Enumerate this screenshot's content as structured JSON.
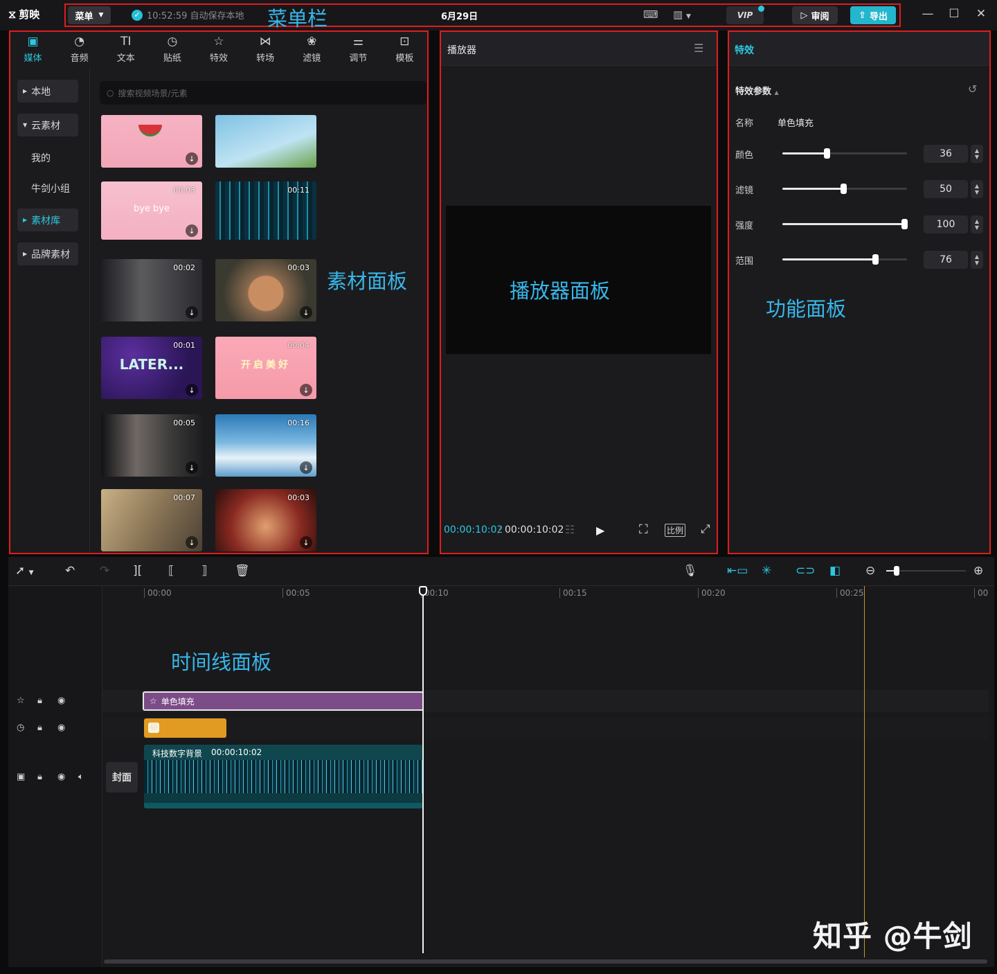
{
  "app": {
    "name": "剪映",
    "menu_label": "菜单",
    "autosave": "10:52:59 自动保存本地",
    "date": "6月29日",
    "vip_label": "VIP",
    "review_label": "审阅",
    "export_label": "导出"
  },
  "annotations": {
    "menubar": "菜单栏",
    "media": "素材面板",
    "player": "播放器面板",
    "function": "功能面板",
    "timeline": "时间线面板"
  },
  "tabs": [
    {
      "label": "媒体",
      "icon": "media-icon"
    },
    {
      "label": "音频",
      "icon": "audio-icon"
    },
    {
      "label": "文本",
      "icon": "text-icon"
    },
    {
      "label": "贴纸",
      "icon": "sticker-icon"
    },
    {
      "label": "特效",
      "icon": "effects-icon"
    },
    {
      "label": "转场",
      "icon": "transition-icon"
    },
    {
      "label": "滤镜",
      "icon": "filter-icon"
    },
    {
      "label": "调节",
      "icon": "adjust-icon"
    },
    {
      "label": "模板",
      "icon": "template-icon"
    }
  ],
  "sidebar": {
    "local": "本地",
    "cloud": "云素材",
    "mine": "我的",
    "group": "牛剑小组",
    "library": "素材库",
    "brand": "品牌素材"
  },
  "search": {
    "placeholder": "搜索视频场景/元素"
  },
  "thumbs": [
    {
      "dur": "",
      "text": ""
    },
    {
      "dur": "",
      "text": ""
    },
    {
      "dur": "00:03",
      "text": "bye bye"
    },
    {
      "dur": "00:11",
      "text": ""
    },
    {
      "dur": "00:02",
      "text": ""
    },
    {
      "dur": "00:03",
      "text": ""
    },
    {
      "dur": "00:01",
      "text": "LATER..."
    },
    {
      "dur": "00:04",
      "text": "开启美好"
    },
    {
      "dur": "00:05",
      "text": ""
    },
    {
      "dur": "00:16",
      "text": ""
    },
    {
      "dur": "00:07",
      "text": ""
    },
    {
      "dur": "00:03",
      "text": ""
    }
  ],
  "player": {
    "title": "播放器",
    "current": "00:00:10:02",
    "total": "00:00:10:02",
    "ratio_label": "比例"
  },
  "effects": {
    "title": "特效",
    "section": "特效参数",
    "name_label": "名称",
    "name_value": "单色填充",
    "params": [
      {
        "label": "颜色",
        "value": "36",
        "level": 0.36
      },
      {
        "label": "滤镜",
        "value": "50",
        "level": 0.5
      },
      {
        "label": "强度",
        "value": "100",
        "level": 1.0
      },
      {
        "label": "范围",
        "value": "76",
        "level": 0.76
      }
    ]
  },
  "timeline": {
    "ticks": [
      "00:00",
      "00:05",
      "00:10",
      "00:15",
      "00:20",
      "00:25",
      "00"
    ],
    "fx_clip": "单色填充",
    "video_clip_name": "科技数字背景",
    "video_clip_dur": "00:00:10:02",
    "cover_label": "封面"
  },
  "watermark": "知乎 @牛剑"
}
